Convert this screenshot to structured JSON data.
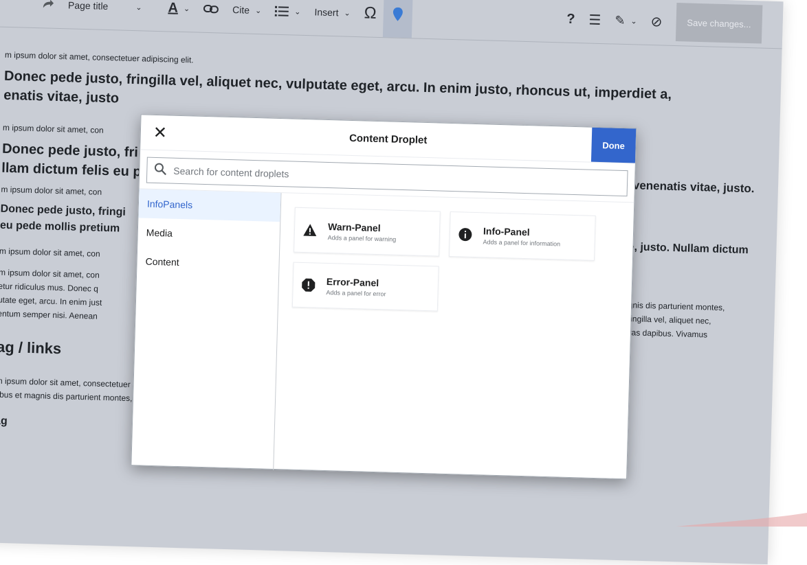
{
  "toolbar": {
    "page_title": "Page title",
    "cite": "Cite",
    "insert": "Insert",
    "help": "?",
    "save": "Save changes..."
  },
  "doc": {
    "line1": "m ipsum dolor sit amet, consectetuer adipiscing elit.",
    "big1a": "Donec pede justo, fringilla vel, aliquet nec, vulputate eget, arcu. In enim justo, rhoncus ut, imperdiet a,",
    "big1b": "enatis vitae, justo",
    "line2": "m ipsum dolor sit amet, con",
    "big2a": "Donec pede justo, fri",
    "big2b": "llam dictum felis eu p",
    "big2r": "a, venenatis vitae, justo.",
    "line3": "m ipsum dolor sit amet, con",
    "big3a": "Donec pede justo, fringi",
    "big3b": "eu pede mollis pretium",
    "big3r": "tae, justo. Nullam dictum",
    "line4": "m ipsum dolor sit amet, con",
    "line5": "m ipsum dolor sit amet, con",
    "line6": "etur ridiculus mus. Donec q",
    "line7": "utate eget, arcu. In enim just",
    "line8": "entum semper nisi. Aenean",
    "r6": "magnis dis parturient montes,",
    "r7": "o, fringilla vel, aliquet nec,",
    "r8": "t. Cras dapibus. Vivamus",
    "heading": "ag / links",
    "bottom1": "m ipsum dolor sit amet, consectetuer adipiscing elit. Aenean commodo ligula eget dolor. Aenean massa. Some text with Blue Link",
    "bottom2": "tibus et magnis dis parturient montes, nascetur ridiculus mus. Donec quam felis, ultricies nec,",
    "heading2": "ag"
  },
  "dialog": {
    "title": "Content Droplet",
    "done": "Done",
    "search_placeholder": "Search for content droplets",
    "sidebar": [
      {
        "label": "InfoPanels"
      },
      {
        "label": "Media"
      },
      {
        "label": "Content"
      }
    ],
    "cards": [
      {
        "title": "Warn-Panel",
        "desc": "Adds a panel for warning",
        "icon": "warning-icon"
      },
      {
        "title": "Info-Panel",
        "desc": "Adds a panel for information",
        "icon": "info-icon"
      },
      {
        "title": "Error-Panel",
        "desc": "Adds a panel for error",
        "icon": "error-icon"
      }
    ]
  },
  "colors": {
    "accent": "#3366cc",
    "selected_bg": "#eaf3ff",
    "overlay_bg": "#c9cdd5",
    "info_marker": "#3a7bd5"
  }
}
